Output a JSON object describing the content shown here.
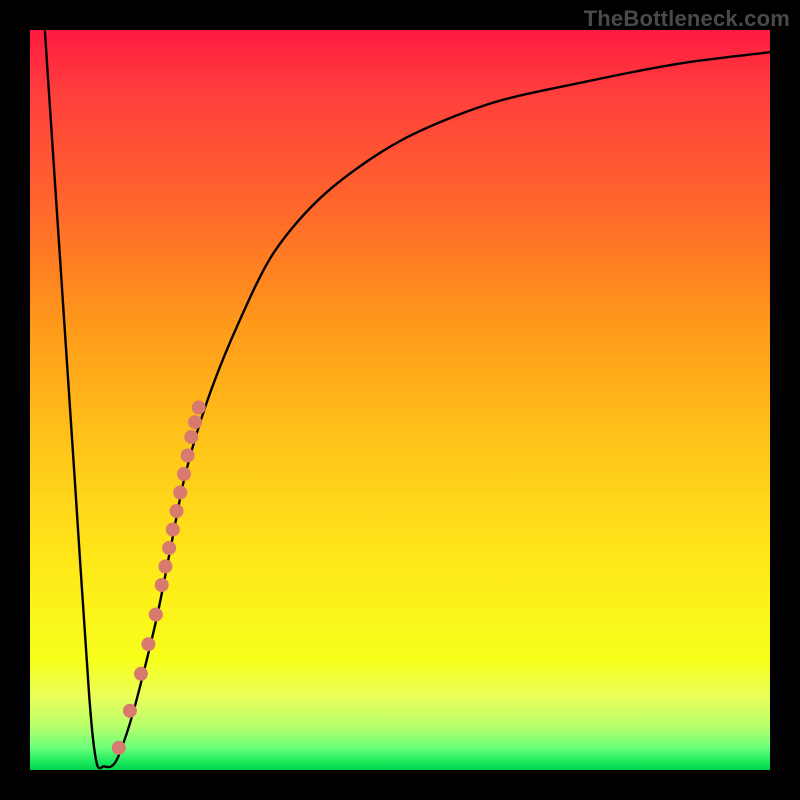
{
  "watermark": "TheBottleneck.com",
  "colors": {
    "frame": "#000000",
    "curve": "#000000",
    "dot": "#d87a6e"
  },
  "chart_data": {
    "type": "line",
    "title": "",
    "xlabel": "",
    "ylabel": "",
    "xlim": [
      0,
      100
    ],
    "ylim": [
      0,
      100
    ],
    "grid": false,
    "legend": false,
    "series": [
      {
        "name": "bottleneck-curve",
        "x": [
          2,
          4,
          6,
          8,
          9,
          10,
          11,
          12,
          14,
          17,
          19,
          21,
          24,
          28,
          33,
          40,
          50,
          62,
          75,
          88,
          100
        ],
        "y": [
          100,
          70,
          40,
          10,
          1,
          0.5,
          0.5,
          2,
          8,
          20,
          30,
          40,
          50,
          60,
          70,
          78,
          85,
          90,
          93,
          95.5,
          97
        ]
      }
    ],
    "markers": [
      {
        "name": "dot",
        "x": 12.0,
        "y": 3.0
      },
      {
        "name": "dot",
        "x": 13.5,
        "y": 8.0
      },
      {
        "name": "dot",
        "x": 15.0,
        "y": 13.0
      },
      {
        "name": "dot",
        "x": 16.0,
        "y": 17.0
      },
      {
        "name": "dot",
        "x": 17.0,
        "y": 21.0
      },
      {
        "name": "dot",
        "x": 17.8,
        "y": 25.0
      },
      {
        "name": "dot",
        "x": 18.3,
        "y": 27.5
      },
      {
        "name": "dot",
        "x": 18.8,
        "y": 30.0
      },
      {
        "name": "dot",
        "x": 19.3,
        "y": 32.5
      },
      {
        "name": "dot",
        "x": 19.8,
        "y": 35.0
      },
      {
        "name": "dot",
        "x": 20.3,
        "y": 37.5
      },
      {
        "name": "dot",
        "x": 20.8,
        "y": 40.0
      },
      {
        "name": "dot",
        "x": 21.3,
        "y": 42.5
      },
      {
        "name": "dot",
        "x": 21.8,
        "y": 45.0
      },
      {
        "name": "dot",
        "x": 22.3,
        "y": 47.0
      },
      {
        "name": "dot",
        "x": 22.8,
        "y": 49.0
      }
    ]
  }
}
